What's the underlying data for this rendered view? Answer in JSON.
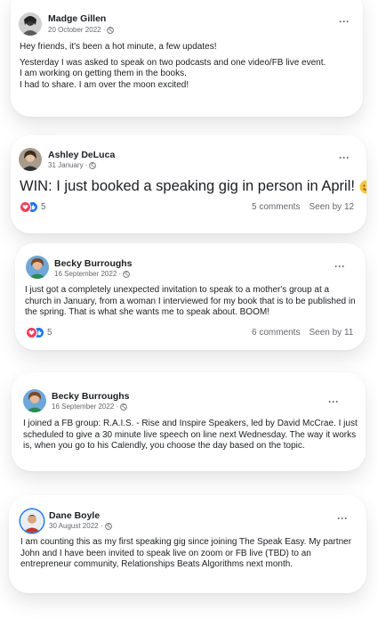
{
  "posts": [
    {
      "author": "Madge Gillen",
      "date": "20 October 2022 ·",
      "paragraphs": [
        "Hey friends, it's been a hot minute, a few updates!",
        "Yesterday I was asked to speak on two podcasts and one video/FB live event.\nI am working on getting them in the books.\nI had to share. I am over the moon excited!"
      ]
    },
    {
      "author": "Ashley DeLuca",
      "date": "31 January ·",
      "headline": "WIN: I just booked a speaking gig in person in April!",
      "reaction_count": "5",
      "comments": "5 comments",
      "seen": "Seen by 12"
    },
    {
      "author": "Becky Burroughs",
      "date": "16 September 2022 ·",
      "paragraphs": [
        "I just got a completely unexpected invitation to speak to a mother's group at a church in January, from a woman I interviewed for my book that is to be published in the spring. That is what she wants me to speak about. BOOM!"
      ],
      "reaction_count": "5",
      "comments": "6 comments",
      "seen": "Seen by 11"
    },
    {
      "author": "Becky Burroughs",
      "date": "16 September 2022 ·",
      "paragraphs": [
        "I joined a FB group: R.A.I.S. - Rise and Inspire Speakers, led by David McCrae. I just scheduled to give a 30 minute live speech on line next Wednesday. The way it works is, when you go to his Calendly, you choose the day based on the topic."
      ]
    },
    {
      "author": "Dane Boyle",
      "date": "30 August 2022 ·",
      "paragraphs": [
        "I am counting this as my first speaking gig since joining The Speak Easy. My partner John and I have been invited to speak live on zoom or FB live (TBD) to an entrepreneur community, Relationships Beats Algorithms next month."
      ]
    }
  ],
  "more_label": "···",
  "colors": {
    "heart": "#f33e58",
    "like": "#1877f2",
    "muted": "#65676b"
  }
}
